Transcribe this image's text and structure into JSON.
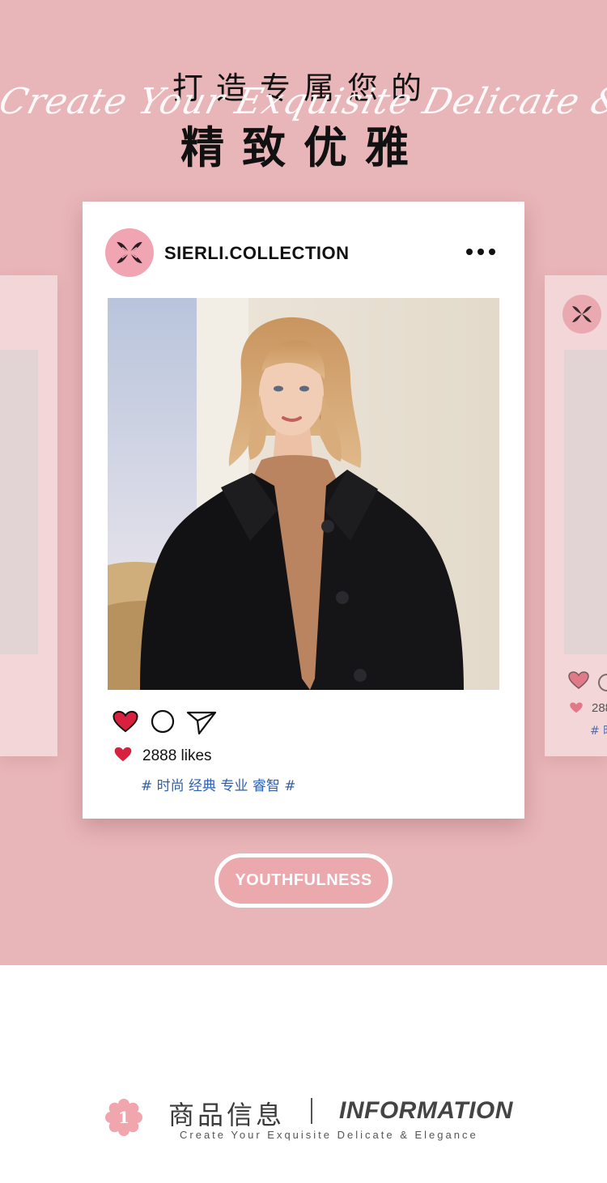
{
  "hero": {
    "title_line1": "打造专属您的",
    "script_line": "Create Your Exquisite Delicate & Elegance",
    "title_line2": "精致优雅"
  },
  "post": {
    "account_name": "SIERLI.COLLECTION",
    "more_icon": "more-dots-icon",
    "photo_alt": "model-in-black-wool-coat",
    "actions": [
      "heart-icon",
      "comment-icon",
      "share-icon"
    ],
    "likes_text": "2888 likes",
    "hashtags": "# 时尚 经典 专业 睿智 #"
  },
  "ghost_right": {
    "likes_text": "288",
    "hashtags": "# 时"
  },
  "badge": {
    "label": "YOUTHFULNESS"
  },
  "section": {
    "number": "1",
    "title_cn": "商品信息",
    "title_en": "INFORMATION",
    "subtitle": "Create Your Exquisite Delicate & Elegance"
  },
  "colors": {
    "hero_bg": "#e8b5b8",
    "heart_red": "#d8213f",
    "tag_blue": "#2f5fb0",
    "accent_pink": "#eba8ad"
  }
}
